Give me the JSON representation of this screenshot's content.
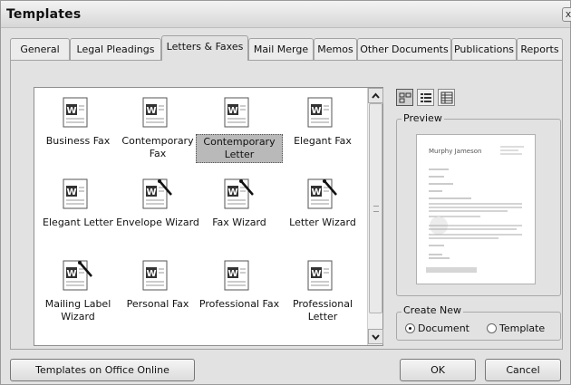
{
  "window": {
    "title": "Templates",
    "close_glyph": "x"
  },
  "tabs": [
    {
      "label": "General",
      "active": false
    },
    {
      "label": "Legal Pleadings",
      "active": false
    },
    {
      "label": "Letters & Faxes",
      "active": true
    },
    {
      "label": "Mail Merge",
      "active": false
    },
    {
      "label": "Memos",
      "active": false
    },
    {
      "label": "Other Documents",
      "active": false
    },
    {
      "label": "Publications",
      "active": false
    },
    {
      "label": "Reports",
      "active": false
    }
  ],
  "templates": [
    {
      "label": "Business Fax",
      "icon": "word-document-icon",
      "selected": false
    },
    {
      "label": "Contemporary Fax",
      "icon": "word-document-icon",
      "selected": false
    },
    {
      "label": "Contemporary Letter",
      "icon": "word-document-icon",
      "selected": true
    },
    {
      "label": "Elegant Fax",
      "icon": "word-document-icon",
      "selected": false
    },
    {
      "label": "Elegant Letter",
      "icon": "word-document-icon",
      "selected": false
    },
    {
      "label": "Envelope Wizard",
      "icon": "wizard-document-icon",
      "selected": false
    },
    {
      "label": "Fax Wizard",
      "icon": "wizard-document-icon",
      "selected": false
    },
    {
      "label": "Letter Wizard",
      "icon": "wizard-document-icon",
      "selected": false
    },
    {
      "label": "Mailing Label Wizard",
      "icon": "wizard-document-icon",
      "selected": false
    },
    {
      "label": "Personal Fax",
      "icon": "word-document-icon",
      "selected": false
    },
    {
      "label": "Professional Fax",
      "icon": "word-document-icon",
      "selected": false
    },
    {
      "label": "Professional Letter",
      "icon": "word-document-icon",
      "selected": false
    }
  ],
  "view_buttons": [
    {
      "name": "large-icons-view-icon",
      "active": true
    },
    {
      "name": "list-view-icon",
      "active": false
    },
    {
      "name": "details-view-icon",
      "active": false
    }
  ],
  "preview": {
    "label": "Preview",
    "doc_heading": "Murphy Jameson"
  },
  "create_new": {
    "label": "Create New",
    "options": [
      {
        "label": "Document",
        "selected": true
      },
      {
        "label": "Template",
        "selected": false
      }
    ]
  },
  "buttons": {
    "office_online": "Templates on Office Online",
    "ok": "OK",
    "cancel": "Cancel"
  }
}
